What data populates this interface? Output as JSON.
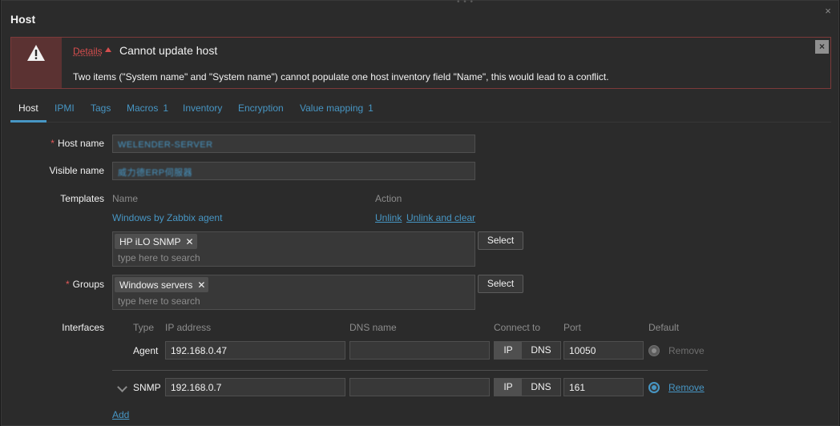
{
  "dialog": {
    "title": "Host",
    "close_glyph": "×",
    "drag_glyph": "• • •"
  },
  "message": {
    "details_label": "Details",
    "title": "Cannot update host",
    "text": "Two items (\"System name\" and \"System name\") cannot populate one host inventory field \"Name\", this would lead to a conflict.",
    "close_glyph": "×",
    "icon": "warning-icon"
  },
  "tabs": [
    {
      "label": "Host",
      "count": ""
    },
    {
      "label": "IPMI",
      "count": ""
    },
    {
      "label": "Tags",
      "count": ""
    },
    {
      "label": "Macros",
      "count": "1"
    },
    {
      "label": "Inventory",
      "count": ""
    },
    {
      "label": "Encryption",
      "count": ""
    },
    {
      "label": "Value mapping",
      "count": "1"
    }
  ],
  "form": {
    "host_name": {
      "label": "Host name",
      "value": "WELENDER-SERVER"
    },
    "visible_name": {
      "label": "Visible name",
      "value": "威力德ERP伺服器"
    },
    "templates": {
      "label": "Templates",
      "col_name": "Name",
      "col_action": "Action",
      "linked": "Windows by Zabbix agent",
      "unlink": "Unlink",
      "unlink_clear": "Unlink and clear",
      "chip": "HP iLO SNMP",
      "placeholder": "type here to search",
      "select": "Select"
    },
    "groups": {
      "label": "Groups",
      "chip": "Windows servers",
      "placeholder": "type here to search",
      "select": "Select"
    },
    "interfaces": {
      "label": "Interfaces",
      "headers": {
        "type": "Type",
        "ip": "IP address",
        "dns": "DNS name",
        "connect": "Connect to",
        "port": "Port",
        "default": "Default"
      },
      "rows": [
        {
          "type": "Agent",
          "ip": "192.168.0.47",
          "dns": "",
          "ip_btn": "IP",
          "dns_btn": "DNS",
          "port": "10050",
          "remove": "Remove"
        },
        {
          "type": "SNMP",
          "ip": "192.168.0.7",
          "dns": "",
          "ip_btn": "IP",
          "dns_btn": "DNS",
          "port": "161",
          "remove": "Remove"
        }
      ],
      "add": "Add"
    }
  },
  "colors": {
    "accent": "#4796c4",
    "error": "#d64e4e",
    "background": "#2b2b2b"
  }
}
